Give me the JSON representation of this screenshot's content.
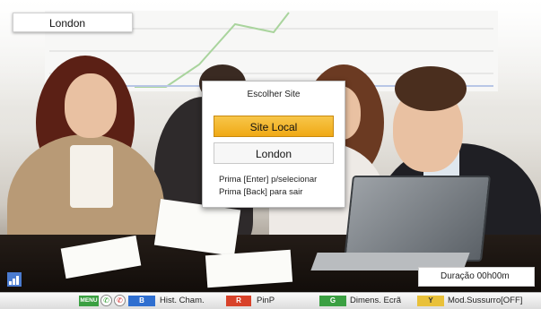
{
  "location_label": "London",
  "dialog": {
    "title": "Escolher Site",
    "options": [
      {
        "label": "Site Local",
        "selected": true
      },
      {
        "label": "London",
        "selected": false
      }
    ],
    "hint_select": "Prima [Enter] p/selecionar",
    "hint_back": "Prima [Back] para sair"
  },
  "duration": "Duração  00h00m",
  "bottom_bar": {
    "menu_key": "MENU",
    "b_key": "B",
    "b_label": "Hist. Cham.",
    "r_key": "R",
    "r_label": "PinP",
    "g_key": "G",
    "g_label": "Dimens. Ecrã",
    "y_key": "Y",
    "y_label": "Mod.Sussurro[OFF]"
  },
  "colors": {
    "selected_option": "#f0a915",
    "key_blue": "#2f6fd0",
    "key_red": "#d8422a",
    "key_green": "#3ba042",
    "key_yellow": "#e9c13a"
  },
  "icons": [
    "call-icon",
    "hang-up-icon",
    "signal-icon"
  ]
}
